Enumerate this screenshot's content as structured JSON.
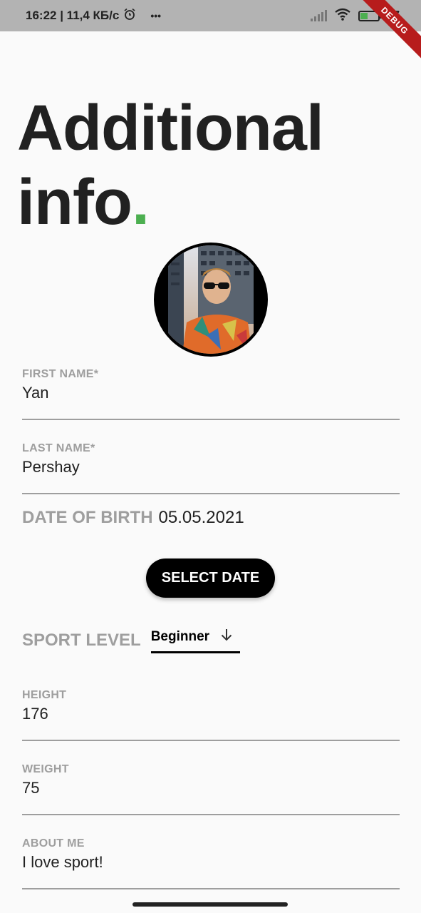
{
  "status_bar": {
    "time_speed": "16:22 | 11,4 КБ/с",
    "alarm_icon": "alarm-icon",
    "more": "•••",
    "battery_text": "37",
    "debug": "DEBUG"
  },
  "title": {
    "line1": "Additional",
    "line2": "info",
    "dot": ".",
    "dot_color": "#4caf50"
  },
  "form": {
    "first_name": {
      "label": "FIRST NAME*",
      "value": "Yan"
    },
    "last_name": {
      "label": "LAST NAME*",
      "value": "Pershay"
    },
    "dob": {
      "label": "DATE OF BIRTH",
      "value": "05.05.2021"
    },
    "select_date_label": "SELECT DATE",
    "sport_level": {
      "label": "SPORT LEVEL",
      "value": "Beginner"
    },
    "height": {
      "label": "HEIGHT",
      "value": "176"
    },
    "weight": {
      "label": "WEIGHT",
      "value": "75"
    },
    "about": {
      "label": "ABOUT ME",
      "value": "I love sport!"
    }
  }
}
